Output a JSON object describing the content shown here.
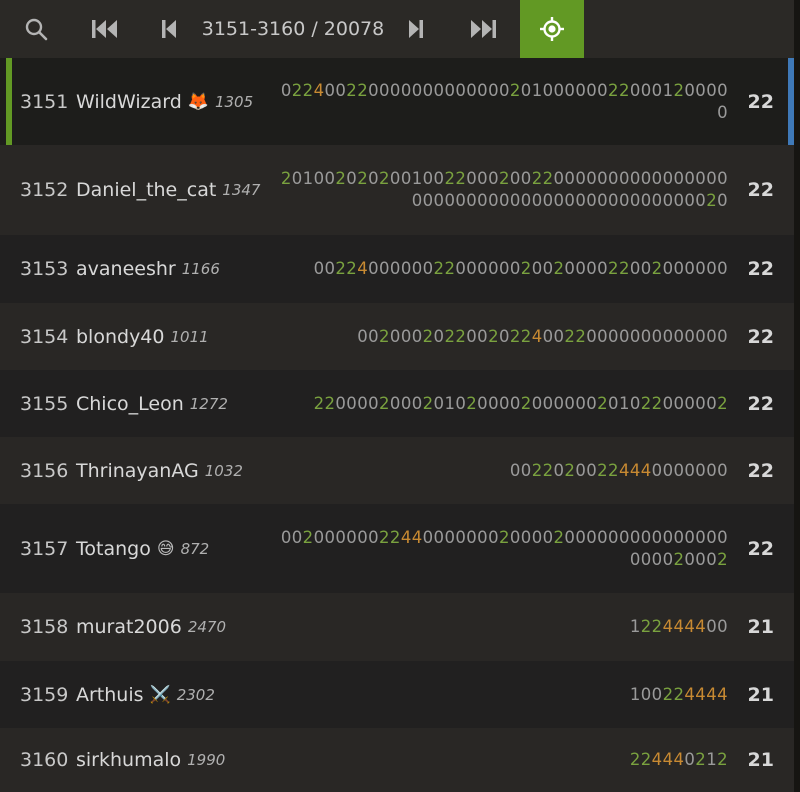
{
  "pager": {
    "search_icon": "search-icon",
    "first_icon": "first-page-icon",
    "prev_icon": "previous-page-icon",
    "range": "3151-3160 / 20078",
    "next_icon": "next-page-icon",
    "last_icon": "last-page-icon",
    "me_icon": "target-icon"
  },
  "colors": {
    "accent_green": "#629924",
    "highlight_blue": "#3f79b8",
    "streak_green": "#7aa23f",
    "streak_orange": "#c88a32"
  },
  "rows": [
    {
      "rank": "3151",
      "name": "WildWizard",
      "emoji": "🦊",
      "rating": "1305",
      "scores": "02240022000000000000020100000022000120000 0",
      "total": "22"
    },
    {
      "rank": "3152",
      "name": "Daniel_the_cat",
      "emoji": "",
      "rating": "1347",
      "scores": "20100202020010022000200220000000000000000 00000000000000000000000000020",
      "total": "22"
    },
    {
      "rank": "3153",
      "name": "avaneeshr",
      "emoji": "",
      "rating": "1166",
      "scores": "00224000000220000002002000022002000000",
      "total": "22"
    },
    {
      "rank": "3154",
      "name": "blondy40",
      "emoji": "",
      "rating": "1011",
      "scores": "0020002022002022400220000000000000",
      "total": "22"
    },
    {
      "rank": "3155",
      "name": "Chico_Leon",
      "emoji": "",
      "rating": "1272",
      "scores": "22000020002010200002000000201022000002",
      "total": "22"
    },
    {
      "rank": "3156",
      "name": "ThrinayanAG",
      "emoji": "",
      "rating": "1032",
      "scores": "00220200224440000000",
      "total": "22"
    },
    {
      "rank": "3157",
      "name": "Totango",
      "emoji": "😅",
      "rating": "872",
      "scores": "00200000022440000000200002000000000000000 000020002",
      "total": "22"
    },
    {
      "rank": "3158",
      "name": "murat2006",
      "emoji": "",
      "rating": "2470",
      "scores": "122444400",
      "total": "21"
    },
    {
      "rank": "3159",
      "name": "Arthuis",
      "emoji": "⚔️",
      "rating": "2302",
      "scores": "100224444",
      "total": "21"
    },
    {
      "rank": "3160",
      "name": "sirkhumalo",
      "emoji": "",
      "rating": "1990",
      "scores": "224440212",
      "total": "21"
    }
  ]
}
